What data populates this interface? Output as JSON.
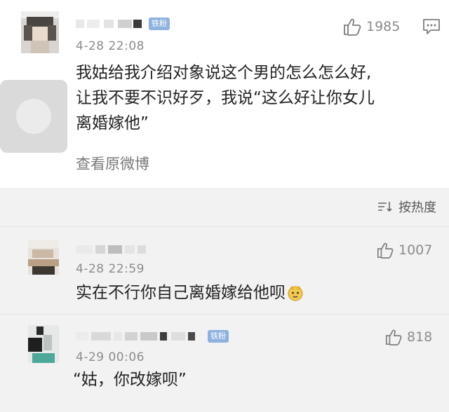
{
  "main_comment": {
    "badge": "铁粉",
    "time": "4-28 22:08",
    "likes": "1985",
    "text_lines": [
      "我姑给我介绍对象说这个男的怎么怎么好,",
      "让我不要不识好歹，我说“这么好让你女儿",
      "离婚嫁他”"
    ],
    "view_original": "查看原微博"
  },
  "sort": {
    "label": "按热度",
    "icon": "sort-icon"
  },
  "replies": [
    {
      "time": "4-28 22:59",
      "likes": "1007",
      "text": "实在不行你自己离婚嫁给他呗",
      "emoji": "doge-emoji"
    },
    {
      "badge": "铁粉",
      "time": "4-29 00:06",
      "likes": "818",
      "text": "“姑，你改嫁呗”"
    }
  ],
  "colors": {
    "badge": "#8eb2e0",
    "muted": "#8c8c8c",
    "card_bg": "#ffffff",
    "page_bg": "#f2f2f2"
  }
}
